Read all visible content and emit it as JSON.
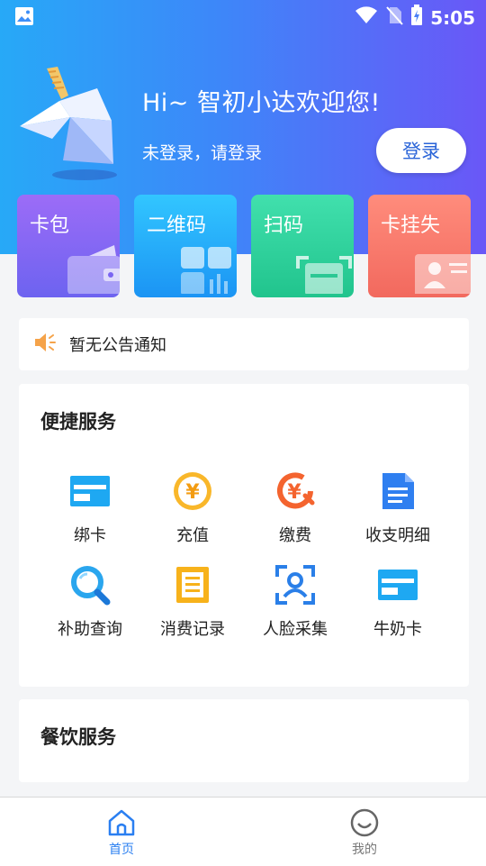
{
  "status_bar": {
    "time": "5:05"
  },
  "header": {
    "greeting": "Hi~ 智初小达欢迎您!",
    "login_hint": "未登录，请登录",
    "login_button": "登录"
  },
  "quick_cards": [
    {
      "label": "卡包",
      "icon": "wallet-icon"
    },
    {
      "label": "二维码",
      "icon": "qr-code-icon"
    },
    {
      "label": "扫码",
      "icon": "scan-icon"
    },
    {
      "label": "卡挂失",
      "icon": "id-card-icon"
    }
  ],
  "notice": {
    "text": "暂无公告通知",
    "icon": "speaker-icon"
  },
  "convenient_services": {
    "title": "便捷服务",
    "items": [
      {
        "label": "绑卡",
        "icon": "bank-card-icon"
      },
      {
        "label": "充值",
        "icon": "yuan-coin-icon"
      },
      {
        "label": "缴费",
        "icon": "payment-icon"
      },
      {
        "label": "收支明细",
        "icon": "document-icon"
      },
      {
        "label": "补助查询",
        "icon": "search-icon"
      },
      {
        "label": "消费记录",
        "icon": "receipt-icon"
      },
      {
        "label": "人脸采集",
        "icon": "face-scan-icon"
      },
      {
        "label": "牛奶卡",
        "icon": "milk-card-icon"
      }
    ]
  },
  "dining_services": {
    "title": "餐饮服务"
  },
  "tab_bar": {
    "items": [
      {
        "label": "首页",
        "icon": "home-icon",
        "active": true
      },
      {
        "label": "我的",
        "icon": "smiley-icon",
        "active": false
      }
    ]
  },
  "colors": {
    "primary": "#2a7ff1",
    "header_gradient_start": "#27a9f7",
    "header_gradient_end": "#6a57f7"
  }
}
